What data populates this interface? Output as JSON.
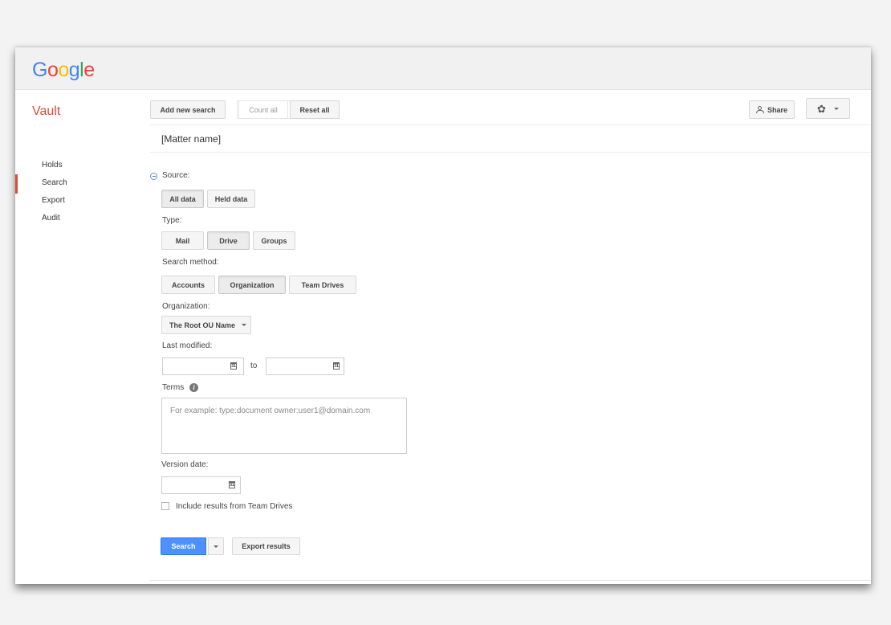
{
  "logo": {
    "letters": [
      {
        "char": "G",
        "color": "#4285F4"
      },
      {
        "char": "o",
        "color": "#EA4335"
      },
      {
        "char": "o",
        "color": "#FBBC05"
      },
      {
        "char": "g",
        "color": "#4285F4"
      },
      {
        "char": "l",
        "color": "#34A853"
      },
      {
        "char": "e",
        "color": "#EA4335"
      }
    ]
  },
  "app": {
    "title": "Vault",
    "accent_color": "#dd4b39"
  },
  "toolbar": {
    "add_new_search": "Add new search",
    "count_all": "Count all",
    "reset_all": "Reset all",
    "share": "Share",
    "settings_icon": "gear-icon"
  },
  "matter": {
    "name": "[Matter name]"
  },
  "sidebar": {
    "items": [
      {
        "label": "Holds",
        "active": false
      },
      {
        "label": "Search",
        "active": true
      },
      {
        "label": "Export",
        "active": false
      },
      {
        "label": "Audit",
        "active": false
      }
    ]
  },
  "form": {
    "source": {
      "label": "Source:",
      "options": [
        "All data",
        "Held data"
      ],
      "selected": "All data"
    },
    "type": {
      "label": "Type:",
      "options": [
        "Mail",
        "Drive",
        "Groups"
      ],
      "selected": "Drive"
    },
    "search_method": {
      "label": "Search method:",
      "options": [
        "Accounts",
        "Organization",
        "Team Drives"
      ],
      "selected": "Organization"
    },
    "organization": {
      "label": "Organization:",
      "value": "The Root OU Name"
    },
    "last_modified": {
      "label": "Last modified:",
      "from": "",
      "to_label": "to",
      "to": "",
      "calendar_glyph": "31"
    },
    "terms": {
      "label": "Terms",
      "placeholder": "For example: type:document owner:user1@domain.com"
    },
    "version_date": {
      "label": "Version date:",
      "value": ""
    },
    "include_team_drives": {
      "label": "Include results from Team Drives",
      "checked": false
    }
  },
  "actions": {
    "search": "Search",
    "export_results": "Export results"
  }
}
